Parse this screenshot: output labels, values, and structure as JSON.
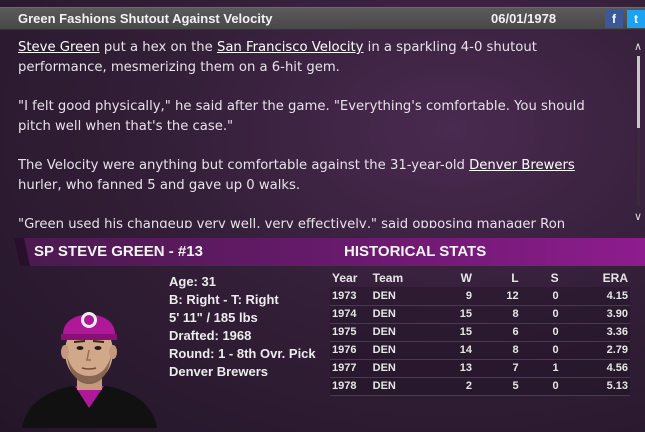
{
  "header": {
    "title": "Green Fashions Shutout Against Velocity",
    "date": "06/01/1978",
    "facebook_icon": "f",
    "twitter_icon": "t"
  },
  "article": {
    "p1": {
      "link1": "Steve Green",
      "text1": " put a hex on the ",
      "link2": "San Francisco Velocity",
      "text2": " in a sparkling 4-0 shutout performance, mesmerizing them on a 6-hit gem."
    },
    "p2": "\"I felt good physically,\" he said after the game. \"Everything's comfortable. You should pitch well when that's the case.\"",
    "p3": {
      "text1": "The Velocity were anything but comfortable against the 31-year-old ",
      "link": "Denver Brewers",
      "text2": " hurler, who fanned 5 and gave up 0 walks."
    },
    "p4": "\"Green used his changeup very well, very effectively,\" said opposing manager Ron Hampton."
  },
  "player": {
    "name": "SP STEVE GREEN - #13",
    "age": "Age: 31",
    "bats_throws": "B: Right - T: Right",
    "height_weight": "5' 11\" / 185 lbs",
    "drafted": "Drafted: 1968",
    "round": "Round: 1 - 8th Ovr. Pick",
    "team": "Denver Brewers"
  },
  "historical": {
    "title": "HISTORICAL STATS",
    "headers": [
      "Year",
      "Team",
      "W",
      "L",
      "S",
      "ERA"
    ],
    "rows": [
      [
        "1973",
        "DEN",
        "9",
        "12",
        "0",
        "4.15"
      ],
      [
        "1974",
        "DEN",
        "15",
        "8",
        "0",
        "3.90"
      ],
      [
        "1975",
        "DEN",
        "15",
        "6",
        "0",
        "3.36"
      ],
      [
        "1976",
        "DEN",
        "14",
        "8",
        "0",
        "2.79"
      ],
      [
        "1977",
        "DEN",
        "13",
        "7",
        "1",
        "4.56"
      ],
      [
        "1978",
        "DEN",
        "2",
        "5",
        "0",
        "5.13"
      ]
    ]
  },
  "colors": {
    "accent_purple": "#8a1a8a",
    "cap_purple": "#b0189a"
  }
}
